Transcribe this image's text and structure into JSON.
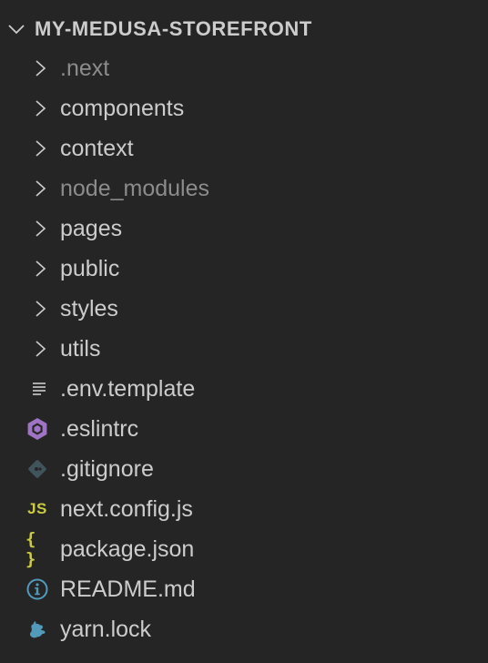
{
  "explorer": {
    "root_title": "MY-MEDUSA-STOREFRONT",
    "folders": [
      {
        "label": ".next",
        "dimmed": true
      },
      {
        "label": "components",
        "dimmed": false
      },
      {
        "label": "context",
        "dimmed": false
      },
      {
        "label": "node_modules",
        "dimmed": true
      },
      {
        "label": "pages",
        "dimmed": false
      },
      {
        "label": "public",
        "dimmed": false
      },
      {
        "label": "styles",
        "dimmed": false
      },
      {
        "label": "utils",
        "dimmed": false
      }
    ],
    "files": [
      {
        "label": ".env.template",
        "icon": "lines-file-icon"
      },
      {
        "label": ".eslintrc",
        "icon": "eslint-icon"
      },
      {
        "label": ".gitignore",
        "icon": "git-icon"
      },
      {
        "label": "next.config.js",
        "icon": "js-icon",
        "icon_text": "JS"
      },
      {
        "label": "package.json",
        "icon": "json-icon",
        "icon_text": "{ }"
      },
      {
        "label": "README.md",
        "icon": "info-icon"
      },
      {
        "label": "yarn.lock",
        "icon": "yarn-icon"
      }
    ]
  },
  "colors": {
    "background": "#252526",
    "text": "#cccccc",
    "dimmed_text": "#8c8c8c",
    "eslint": "#a074c4",
    "git": "#41535b",
    "js": "#cbcb41",
    "info": "#519aba",
    "yarn": "#519aba"
  }
}
